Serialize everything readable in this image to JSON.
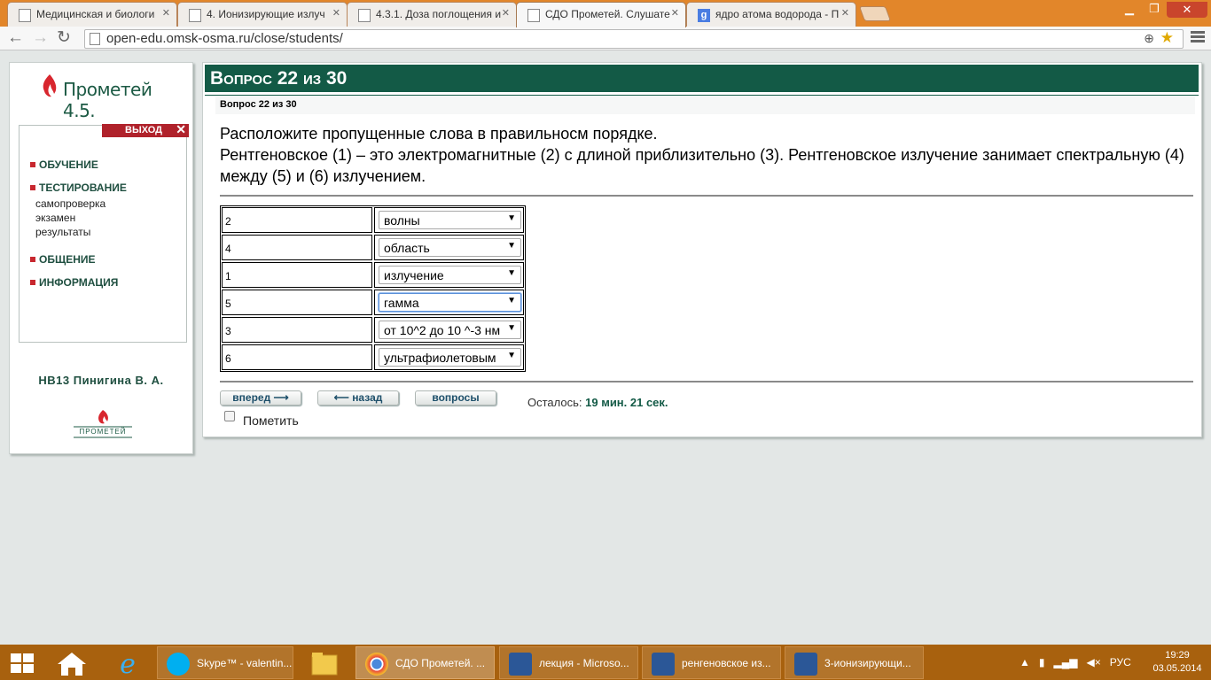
{
  "browser": {
    "tabs": [
      {
        "label": "Медицинская и биологи",
        "icon": "page-icon"
      },
      {
        "label": "4. Ионизирующие излуч",
        "icon": "page-icon"
      },
      {
        "label": "4.3.1. Доза поглощения и",
        "icon": "page-icon"
      },
      {
        "label": "СДО Прометей. Слушате",
        "icon": "page-icon",
        "active": true
      },
      {
        "label": "ядро атома водорода - П",
        "icon": "google-icon"
      }
    ],
    "url": "open-edu.omsk-osma.ru/close/students/"
  },
  "sidebar": {
    "logo_text": "Прометей 4.5.",
    "exit_label": "ВЫХОД",
    "menu": {
      "learning": "ОБУЧЕНИЕ",
      "testing": "ТЕСТИРОВАНИЕ",
      "testing_items": [
        "самопроверка",
        "экзамен",
        "результаты"
      ],
      "communication": "ОБЩЕНИЕ",
      "information": "ИНФОРМАЦИЯ"
    },
    "user_name": "НВ13 Пинигина В. А.",
    "bottom_logo_text": "ПРОМЕТЕЙ"
  },
  "question": {
    "header": "Вопрос 22 из 30",
    "subheader": "Вопрос 22 из 30",
    "line1": "Расположите пропущенные слова в правильносм порядке.",
    "line2": "Рентгеновское (1) – это электромагнитные (2) с длиной приблизительно (3). Рентгеновское излучение занимает спектральную (4) между (5) и (6) излучением.",
    "rows": [
      {
        "num": "2",
        "value": "волны"
      },
      {
        "num": "4",
        "value": "область"
      },
      {
        "num": "1",
        "value": "излучение"
      },
      {
        "num": "5",
        "value": "гамма",
        "focused": true
      },
      {
        "num": "3",
        "value": "от 10^2 до 10 ^-3 нм"
      },
      {
        "num": "6",
        "value": "ультрафиолетовым"
      }
    ]
  },
  "controls": {
    "forward": "вперед",
    "back": "назад",
    "questions": "вопросы",
    "timer_label": "Осталось:",
    "timer_value": "19 мин. 21 сек.",
    "mark_label": "Пометить"
  },
  "taskbar": {
    "items": [
      {
        "label": "Skype™ - valentin...",
        "icon": "skype-icon"
      },
      {
        "label": "СДО Прометей. ...",
        "icon": "chrome-icon",
        "active": true
      },
      {
        "label": "лекция - Microso...",
        "icon": "word-icon"
      },
      {
        "label": "ренгеновское из...",
        "icon": "word-icon"
      },
      {
        "label": "3-ионизирующи...",
        "icon": "word-icon"
      }
    ],
    "lang": "РУС",
    "time": "19:29",
    "date": "03.05.2014"
  },
  "colors": {
    "accent": "#135a46",
    "titlebar": "#e2862a",
    "taskbar": "#a8610e",
    "exit": "#b0222b"
  }
}
